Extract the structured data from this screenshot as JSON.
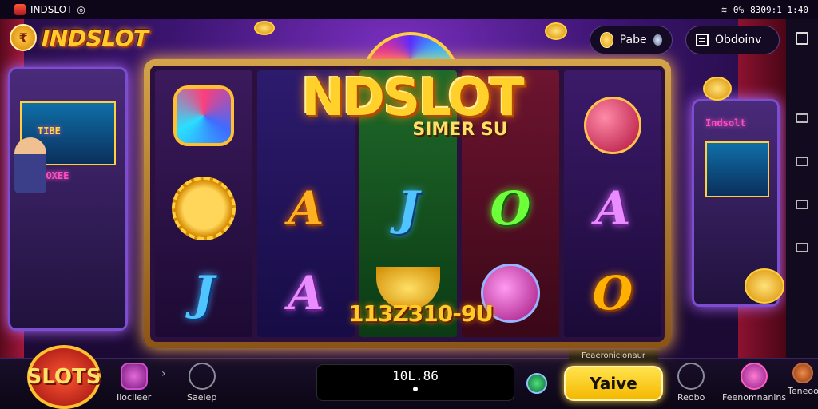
{
  "status": {
    "app_name": "INDSLOT",
    "right_text": "8309:1 1:40",
    "battery": "0%"
  },
  "logo": {
    "text": "INDSLOT"
  },
  "top_pills": {
    "coins_label": "Pabe",
    "menu_label": "Obdoinv"
  },
  "banner": {
    "title": "NDSLOT",
    "subtitle": "SIMER SU"
  },
  "reels": [
    [
      "gem",
      "sun",
      "J"
    ],
    [
      "A",
      "A"
    ],
    [
      "J",
      "lamp"
    ],
    [
      "O",
      "orb"
    ],
    [
      "fruit",
      "A",
      "O"
    ]
  ],
  "win_counter": "113Z310-9U",
  "arcade": {
    "left_screen": "TIBE",
    "left_label": "VIOXEE",
    "right_sign": "Indsolt"
  },
  "bottom": {
    "big_button": "SLOTS",
    "nav_left": [
      {
        "label": "Iiocileer",
        "icon": "gear-icon"
      },
      {
        "label": "Saelep",
        "icon": "camera-icon"
      }
    ],
    "balance": "10L.86",
    "spin_caption": "Feaeronicionaur",
    "spin_label": "Yaive",
    "nav_right": [
      {
        "label": "Reobo",
        "icon": "shield-icon"
      },
      {
        "label": "Feenomnanins",
        "icon": "profile-icon"
      },
      {
        "label": "Teneoo",
        "icon": "trophy-icon"
      }
    ]
  }
}
